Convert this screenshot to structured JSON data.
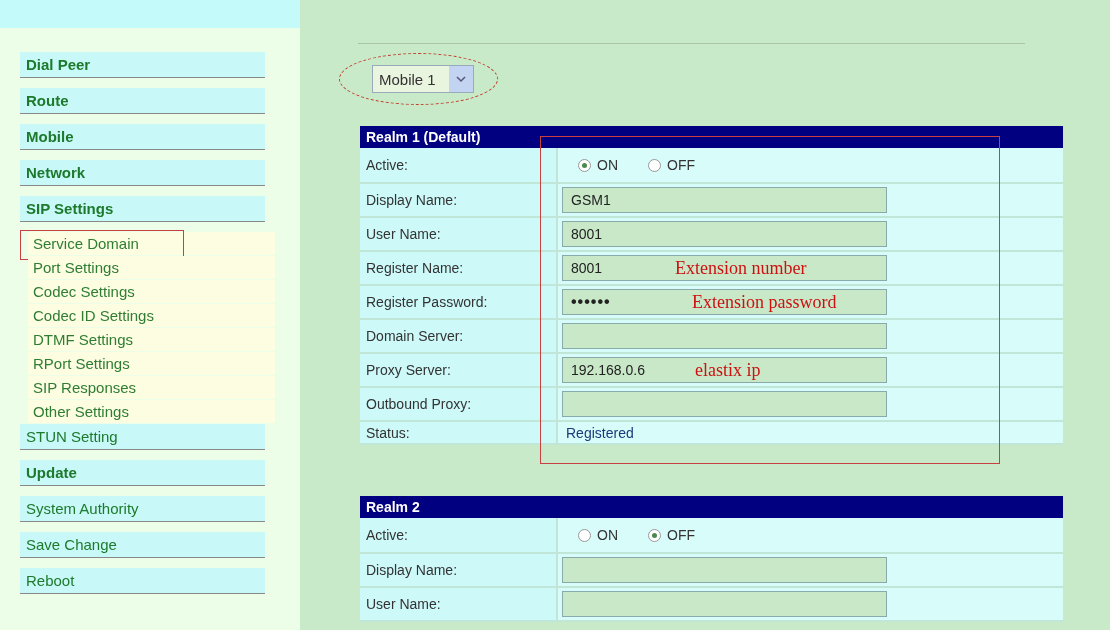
{
  "sidebar": {
    "items": [
      {
        "label": "Dial Peer",
        "kind": "menu",
        "bold": true
      },
      {
        "label": "Route",
        "kind": "menu",
        "bold": true
      },
      {
        "label": "Mobile",
        "kind": "menu",
        "bold": true
      },
      {
        "label": "Network",
        "kind": "menu",
        "bold": true
      },
      {
        "label": "SIP Settings",
        "kind": "menu",
        "bold": true
      },
      {
        "label": "Service Domain",
        "kind": "submenu",
        "bold": false,
        "highlighted": true
      },
      {
        "label": "Port Settings",
        "kind": "submenu",
        "bold": false,
        "highlighted": false
      },
      {
        "label": "Codec Settings",
        "kind": "submenu",
        "bold": false,
        "highlighted": false
      },
      {
        "label": "Codec ID Settings",
        "kind": "submenu",
        "bold": false,
        "highlighted": false
      },
      {
        "label": "DTMF Settings",
        "kind": "submenu",
        "bold": false,
        "highlighted": false
      },
      {
        "label": "RPort Settings",
        "kind": "submenu",
        "bold": false,
        "highlighted": false
      },
      {
        "label": "SIP Responses",
        "kind": "submenu",
        "bold": false,
        "highlighted": false
      },
      {
        "label": "Other Settings",
        "kind": "submenu",
        "bold": false,
        "highlighted": false
      },
      {
        "label": "STUN Setting",
        "kind": "menu",
        "bold": false
      },
      {
        "label": "Update",
        "kind": "menu",
        "bold": true
      },
      {
        "label": "System Authority",
        "kind": "menu",
        "bold": false
      },
      {
        "label": "Save Change",
        "kind": "menu",
        "bold": false
      },
      {
        "label": "Reboot",
        "kind": "menu",
        "bold": false
      }
    ]
  },
  "device_select": {
    "value": "Mobile 1",
    "highlighted": true
  },
  "realms": [
    {
      "title": "Realm 1 (Default)",
      "highlighted": true,
      "rows": [
        {
          "kind": "radio",
          "label": "Active:",
          "options": [
            {
              "label": "ON",
              "selected": true
            },
            {
              "label": "OFF",
              "selected": false
            }
          ]
        },
        {
          "kind": "text",
          "label": "Display Name:",
          "value": "GSM1"
        },
        {
          "kind": "text",
          "label": "User Name:",
          "value": "8001"
        },
        {
          "kind": "text",
          "label": "Register Name:",
          "value": "8001",
          "note": "Extension number"
        },
        {
          "kind": "password",
          "label": "Register Password:",
          "value": "••••••",
          "note": "Extension password"
        },
        {
          "kind": "text",
          "label": "Domain Server:"
        },
        {
          "kind": "text",
          "label": "Proxy Server:",
          "value": "192.168.0.6",
          "note": "elastix ip"
        },
        {
          "kind": "text",
          "label": "Outbound Proxy:"
        },
        {
          "kind": "status",
          "label": "Status:",
          "value": "Registered"
        }
      ]
    },
    {
      "title": "Realm 2",
      "highlighted": false,
      "rows": [
        {
          "kind": "radio",
          "label": "Active:",
          "options": [
            {
              "label": "ON",
              "selected": false
            },
            {
              "label": "OFF",
              "selected": true
            }
          ]
        },
        {
          "kind": "text",
          "label": "Display Name:"
        },
        {
          "kind": "text",
          "label": "User Name:"
        }
      ]
    }
  ]
}
